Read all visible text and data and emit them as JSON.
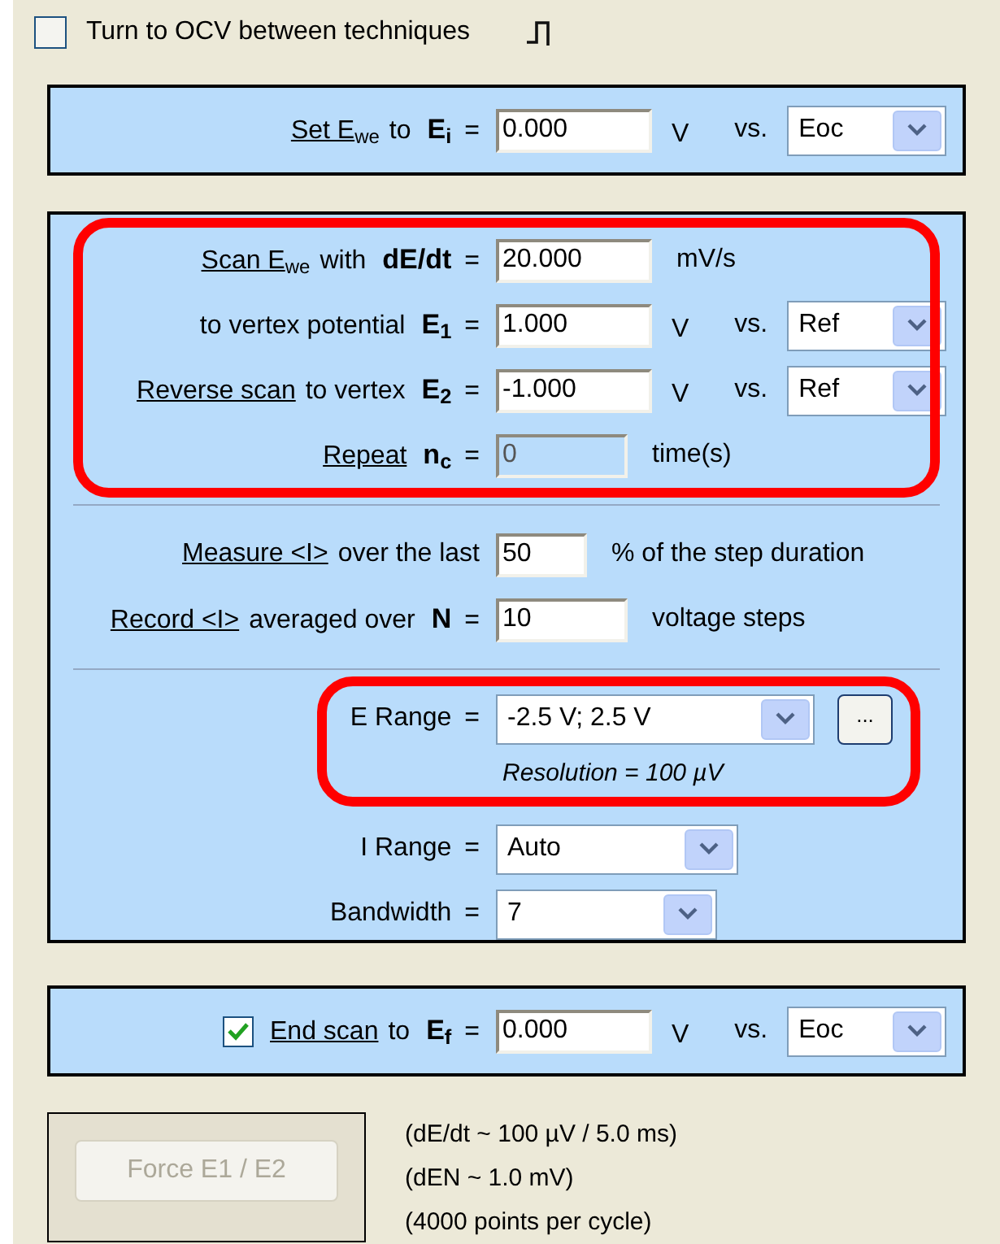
{
  "ocv": {
    "label": "Turn to OCV between techniques",
    "checked": false
  },
  "set_panel": {
    "rows": [
      {
        "kind": "field",
        "link": "Set E$_{we}$",
        "text": "to",
        "symbol": "E$_{i}$",
        "eq": "=",
        "value": "0.000",
        "disabled": false,
        "unit": "V",
        "vs": "vs.",
        "ref": "Eoc"
      }
    ]
  },
  "scan_panel": {
    "groups": [
      {
        "highlighted": true,
        "divider_after": true,
        "rows": [
          {
            "kind": "field",
            "link": "Scan E$_{we}$",
            "text": "with",
            "symbol": "dE/dt",
            "eq": "=",
            "value": "20.000",
            "disabled": false,
            "unit": "mV/s"
          },
          {
            "kind": "field",
            "text": "to vertex potential",
            "symbol": "E$_{1}$",
            "eq": "=",
            "value": "1.000",
            "disabled": false,
            "unit": "V",
            "vs": "vs.",
            "ref": "Ref"
          },
          {
            "kind": "field",
            "link": "Reverse scan",
            "text": "to vertex",
            "symbol": "E$_{2}$",
            "eq": "=",
            "value": "-1.000",
            "disabled": false,
            "unit": "V",
            "vs": "vs.",
            "ref": "Ref"
          },
          {
            "kind": "field",
            "link": "Repeat",
            "symbol": "n$_{c}$",
            "eq": "=",
            "value": "0",
            "disabled": true,
            "unit": "time(s)"
          }
        ]
      },
      {
        "highlighted": false,
        "divider_after": true,
        "rows": [
          {
            "kind": "field",
            "link": "Measure <I>",
            "text": "over the last",
            "value": "50",
            "disabled": false,
            "unit": "% of the step duration"
          },
          {
            "kind": "field",
            "link": "Record <I>",
            "text": "averaged over",
            "symbol": "N",
            "eq": "=",
            "value": "10",
            "disabled": false,
            "unit": "voltage steps"
          }
        ]
      },
      {
        "highlighted": true,
        "divider_after": false,
        "rows": [
          {
            "kind": "select",
            "text": "E Range",
            "eq": "=",
            "value": "-2.5 V; 2.5 V",
            "browse": "..."
          },
          {
            "kind": "note",
            "text": "Resolution = 100 µV"
          }
        ]
      },
      {
        "highlighted": false,
        "divider_after": false,
        "rows": [
          {
            "kind": "select",
            "text": "I Range",
            "eq": "=",
            "value": "Auto"
          },
          {
            "kind": "select",
            "text": "Bandwidth",
            "eq": "=",
            "value": "7"
          }
        ]
      }
    ]
  },
  "end_panel": {
    "rows": [
      {
        "kind": "field",
        "checked": true,
        "link": "End scan",
        "text": "to",
        "symbol": "E$_{f}$",
        "eq": "=",
        "value": "0.000",
        "disabled": false,
        "unit": "V",
        "vs": "vs.",
        "ref": "Eoc"
      }
    ]
  },
  "force_button": {
    "label": "Force E1 / E2",
    "disabled": true
  },
  "info_lines": [
    "(dE/dt ~ 100 µV / 5.0 ms)",
    "(dEN ~ 1.0 mV)",
    "(4000 points per cycle)"
  ]
}
